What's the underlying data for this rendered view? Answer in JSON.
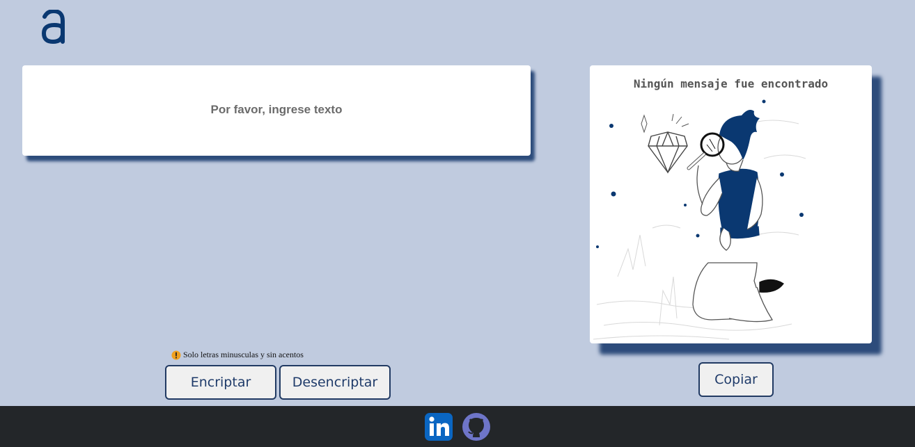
{
  "logo": {
    "icon": "alura-logo-icon",
    "color": "#0a3871"
  },
  "input": {
    "placeholder": "Por favor, ingrese texto",
    "value": ""
  },
  "warning": {
    "icon": "warning-icon",
    "text": "Solo letras minusculas y sin acentos"
  },
  "buttons": {
    "encrypt_label": "Encriptar",
    "decrypt_label": "Desencriptar",
    "copy_label": "Copiar"
  },
  "output": {
    "title": "Ningún mensaje fue encontrado",
    "illustration": "person-with-magnifier-illustration"
  },
  "footer": {
    "links": [
      {
        "icon": "linkedin-icon",
        "color": "#0a66c2"
      },
      {
        "icon": "github-icon",
        "color": "#6e75c8"
      }
    ]
  },
  "colors": {
    "background": "#c0cbdf",
    "accent": "#0a3871",
    "footer": "#232629"
  }
}
